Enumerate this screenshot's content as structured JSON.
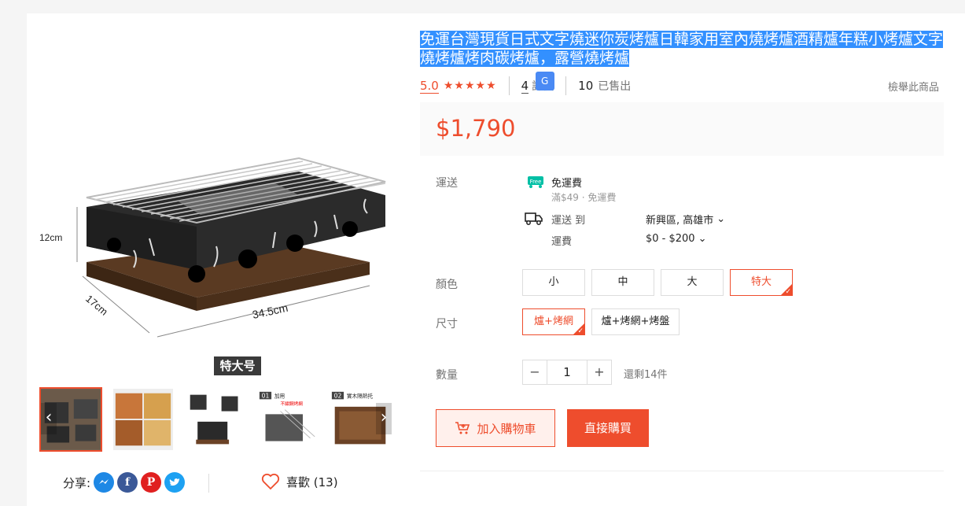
{
  "colors": {
    "accent": "#ee4d2d",
    "selection": "#3390ff",
    "translate": "#4a8af4"
  },
  "gallery": {
    "main_image_labels": {
      "height": "12cm",
      "depth": "17cm",
      "width": "34.5cm",
      "size_tag": "特大号"
    },
    "thumbnails": [
      {
        "name": "grill-set-thumb",
        "badge": ""
      },
      {
        "name": "food-dishes-thumb",
        "badge": ""
      },
      {
        "name": "grill-angles-thumb",
        "badge": ""
      },
      {
        "name": "grill-net-thumb",
        "badge": "01",
        "caption": "加用",
        "caption2": "不鏽鋼烤網"
      },
      {
        "name": "wooden-tray-thumb",
        "badge": "02",
        "caption": "實木隔熱托"
      }
    ],
    "prev_icon": "‹",
    "next_icon": "›"
  },
  "share": {
    "label": "分享:",
    "icons": [
      "messenger-icon",
      "facebook-icon",
      "pinterest-icon",
      "twitter-icon"
    ]
  },
  "like": {
    "label": "喜歡 (13)"
  },
  "product": {
    "title": "免運台灣現貨日式文字燒迷你炭烤爐日韓家用室內燒烤爐酒精爐年糕小烤爐文字燒烤爐烤肉碳烤爐，露營燒烤爐",
    "rating": "5.0",
    "stars": "★★★★★",
    "reviews_count": "4",
    "reviews_label": "評價",
    "sold_count": "10",
    "sold_label": "已售出",
    "report": "檢舉此商品",
    "price": "$1,790"
  },
  "shipping": {
    "label": "運送",
    "free_badge": "Free",
    "free_title": "免運費",
    "free_sub": "滿$49 · 免運費",
    "to_label": "運送 到",
    "to_value": "新興區, 高雄市",
    "fee_label": "運費",
    "fee_value": "$0 - $200"
  },
  "color": {
    "label": "顏色",
    "options": [
      "小",
      "中",
      "大",
      "特大"
    ],
    "selected": "特大"
  },
  "size": {
    "label": "尺寸",
    "options": [
      "爐+烤網",
      "爐+烤網+烤盤"
    ],
    "selected": "爐+烤網"
  },
  "quantity": {
    "label": "數量",
    "minus": "−",
    "value": "1",
    "plus": "+",
    "stock": "還剩14件"
  },
  "actions": {
    "add_to_cart": "加入購物車",
    "buy_now": "直接購買"
  }
}
